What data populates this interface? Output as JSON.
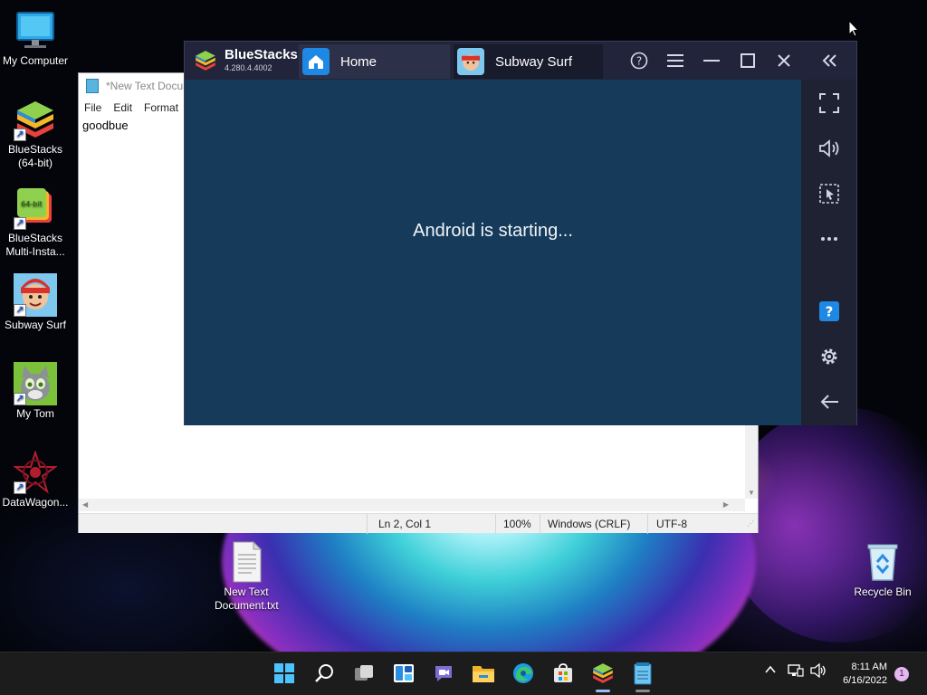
{
  "desktop": {
    "icons": [
      {
        "label": "My Computer",
        "icon": "monitor-icon"
      },
      {
        "label": "BlueStacks (64-bit)",
        "icon": "bluestacks-icon"
      },
      {
        "label": "BlueStacks Multi-Insta...",
        "icon": "bluestacks-multi-instance-icon"
      },
      {
        "label": "Subway Surf",
        "icon": "subway-surf-icon"
      },
      {
        "label": "My Tom",
        "icon": "my-tom-icon"
      },
      {
        "label": "DataWagon...",
        "icon": "datawagon-icon"
      },
      {
        "label": "New Text Document.txt",
        "icon": "text-file-icon"
      },
      {
        "label": "Recycle Bin",
        "icon": "recycle-bin-icon"
      }
    ]
  },
  "notepad": {
    "title": "*New Text Docun",
    "menu": [
      "File",
      "Edit",
      "Format"
    ],
    "content": "goodbue",
    "status": {
      "position": "Ln 2, Col 1",
      "zoom": "100%",
      "line_endings": "Windows (CRLF)",
      "encoding": "UTF-8"
    }
  },
  "bluestacks": {
    "name": "BlueStacks",
    "version": "4.280.4.4002",
    "tabs": [
      {
        "label": "Home",
        "icon": "home-icon"
      },
      {
        "label": "Subway Surf",
        "icon": "subway-surf-icon"
      }
    ],
    "controls": [
      "help-icon",
      "menu-icon",
      "minimize-icon",
      "maximize-icon",
      "close-icon",
      "collapse-sidebar-icon"
    ],
    "screen_message": "Android is starting...",
    "sidebar": [
      "fullscreen-icon",
      "volume-icon",
      "cursor-select-icon",
      "more-icon",
      "help-icon",
      "settings-icon",
      "back-icon"
    ],
    "colors": {
      "screen": "#163a5a",
      "chrome": "#21243a",
      "accent": "#1e88e5"
    }
  },
  "taskbar": {
    "apps": [
      "start-icon",
      "search-icon",
      "task-view-icon",
      "widgets-icon",
      "teams-chat-icon",
      "file-explorer-icon",
      "edge-icon",
      "store-icon",
      "bluestacks-icon",
      "notepad-icon"
    ],
    "tray": [
      "chevron-up-icon",
      "network-icon",
      "volume-icon"
    ],
    "time": "8:11 AM",
    "date": "6/16/2022",
    "notification_count": "1"
  }
}
